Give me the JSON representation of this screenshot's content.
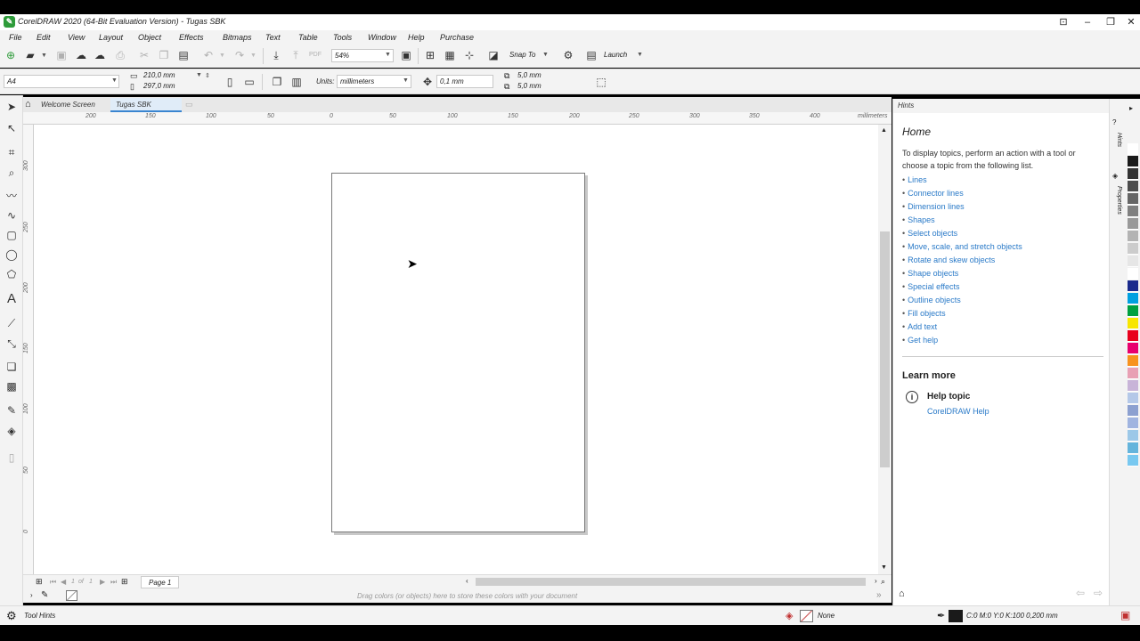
{
  "window": {
    "title": "CorelDRAW 2020 (64-Bit Evaluation Version) - Tugas SBK",
    "app_icon": "coreldraw-logo",
    "app_icon_glyph": "✎"
  },
  "menu": [
    "File",
    "Edit",
    "View",
    "Layout",
    "Object",
    "Effects",
    "Bitmaps",
    "Text",
    "Table",
    "Tools",
    "Window",
    "Help",
    "Purchase"
  ],
  "toolbar": {
    "zoom": "54%",
    "snap_label": "Snap To",
    "launch_label": "Launch"
  },
  "property_bar": {
    "page_size": "A4",
    "width": "210,0 mm",
    "height": "297,0 mm",
    "units_label": "Units:",
    "units_value": "millimeters",
    "nudge": "0,1 mm",
    "dup_x": "5,0 mm",
    "dup_y": "5,0 mm"
  },
  "doc_tabs": [
    "Welcome Screen",
    "Tugas SBK"
  ],
  "ruler": {
    "unit": "millimeters",
    "h_labels": [
      "200",
      "150",
      "100",
      "50",
      "0",
      "50",
      "100",
      "150",
      "200",
      "250",
      "300",
      "350",
      "400"
    ],
    "v_labels": [
      "300",
      "250",
      "200",
      "150",
      "100",
      "50",
      "0"
    ]
  },
  "page_nav": {
    "current": "1",
    "of_label": "of",
    "total": "1",
    "tab": "Page 1"
  },
  "color_docker_hint": "Drag colors (or objects) here to store these colors with your document",
  "status": {
    "tool_hints": "Tool Hints",
    "fill": "None",
    "outline": "C:0 M:0 Y:0 K:100  0,200 mm"
  },
  "hints_panel": {
    "header": "Hints",
    "heading": "Home",
    "intro": "To display topics, perform an action with a tool or choose a topic from the following list.",
    "topics": [
      "Lines",
      "Connector lines",
      "Dimension lines",
      "Shapes",
      "Select objects",
      "Move, scale, and stretch objects",
      "Rotate and skew objects",
      "Shape objects",
      "Special effects",
      "Outline objects",
      "Fill objects",
      "Add text",
      "Get help"
    ],
    "learn_more": "Learn more",
    "help_topic": "Help topic",
    "help_link": "CorelDRAW Help"
  },
  "side_tabs": [
    "Hints",
    "Properties"
  ],
  "palette": [
    "#ffffff",
    "#1a1a1a",
    "#333333",
    "#4d4d4d",
    "#666666",
    "#808080",
    "#999999",
    "#b3b3b3",
    "#cccccc",
    "#e6e6e6",
    "#ffffff",
    "#1a2a8c",
    "#00a0e0",
    "#00a040",
    "#f7e600",
    "#e8001c",
    "#e8006e",
    "#f7931e",
    "#e8a0b4",
    "#c8b4d8",
    "#b4c8e8",
    "#8ca0d0",
    "#a0b4e0",
    "#9cc8e8",
    "#64b4dc",
    "#78c8f0"
  ]
}
